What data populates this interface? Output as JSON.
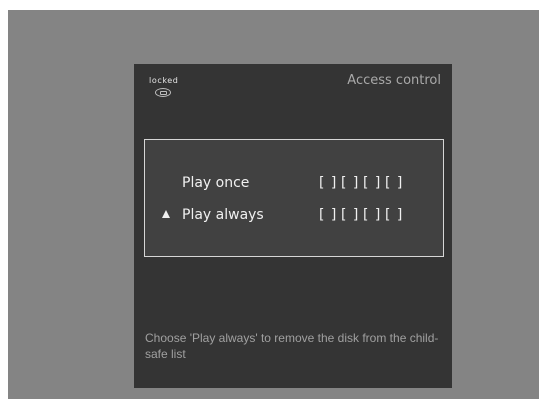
{
  "header": {
    "status": "locked",
    "status_icon": "lock-icon",
    "title": "Access control"
  },
  "dialog": {
    "options": [
      {
        "label": "Play once",
        "selected": false,
        "code": [
          "[ ]",
          "[ ]",
          "[ ]",
          "[ ]"
        ]
      },
      {
        "label": "Play always",
        "selected": true,
        "code": [
          "[ ]",
          "[ ]",
          "[ ]",
          "[ ]"
        ]
      }
    ]
  },
  "hint": "Choose 'Play always' to remove the disk from the child-safe list",
  "colors": {
    "background": "#848484",
    "screen": "#343434",
    "dialog": "#414141",
    "text": "#f0f0f0"
  }
}
